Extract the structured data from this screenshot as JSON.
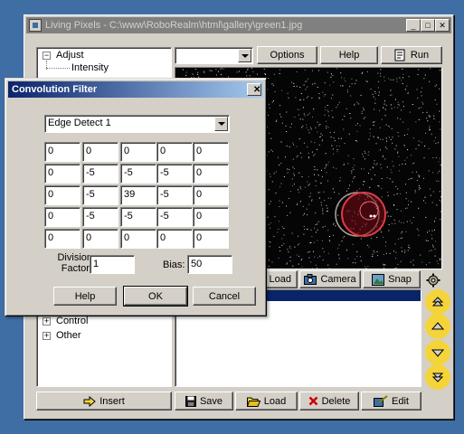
{
  "window": {
    "title": "Living Pixels - C:\\www\\RoboRealm\\html\\gallery\\green1.jpg",
    "minimize": "_",
    "maximize": "□",
    "close": "✕"
  },
  "tree": {
    "items": [
      {
        "label": "Adjust",
        "expander": "−"
      },
      {
        "label": "Intensity",
        "expander": ""
      },
      {
        "label": "Control",
        "expander": "+"
      },
      {
        "label": "Other",
        "expander": "+"
      }
    ]
  },
  "toolbar": {
    "options_label": "Options",
    "help_label": "Help",
    "run_label": "Run"
  },
  "capture": {
    "load_label": "Load",
    "camera_label": "Camera",
    "snap_label": "Snap"
  },
  "bottom_bar": {
    "insert_label": "Insert",
    "save_label": "Save",
    "load_label": "Load",
    "delete_label": "Delete",
    "edit_label": "Edit"
  },
  "dialog": {
    "title": "Convolution Filter",
    "close": "✕",
    "filter_selected": "Edge Detect 1",
    "matrix": [
      [
        "0",
        "0",
        "0",
        "0",
        "0"
      ],
      [
        "0",
        "-5",
        "-5",
        "-5",
        "0"
      ],
      [
        "0",
        "-5",
        "39",
        "-5",
        "0"
      ],
      [
        "0",
        "-5",
        "-5",
        "-5",
        "0"
      ],
      [
        "0",
        "0",
        "0",
        "0",
        "0"
      ]
    ],
    "division_label": "Division",
    "factor_label": "Factor:",
    "division_value": "1",
    "bias_label": "Bias:",
    "bias_value": "50",
    "help_label": "Help",
    "ok_label": "OK",
    "cancel_label": "Cancel"
  },
  "colors": {
    "desktop": "#3f6ea5",
    "selection": "#0a246a",
    "yellow_icon": "#f5d43a",
    "delete_x": "#cc0000"
  },
  "icons": [
    "app-icon",
    "run-icon",
    "camera-icon",
    "snap-icon",
    "insert-icon",
    "save-icon",
    "load-icon",
    "delete-icon",
    "edit-icon",
    "gear-icon",
    "move-top-icon",
    "move-up-icon",
    "move-down-icon",
    "move-bottom-icon"
  ]
}
